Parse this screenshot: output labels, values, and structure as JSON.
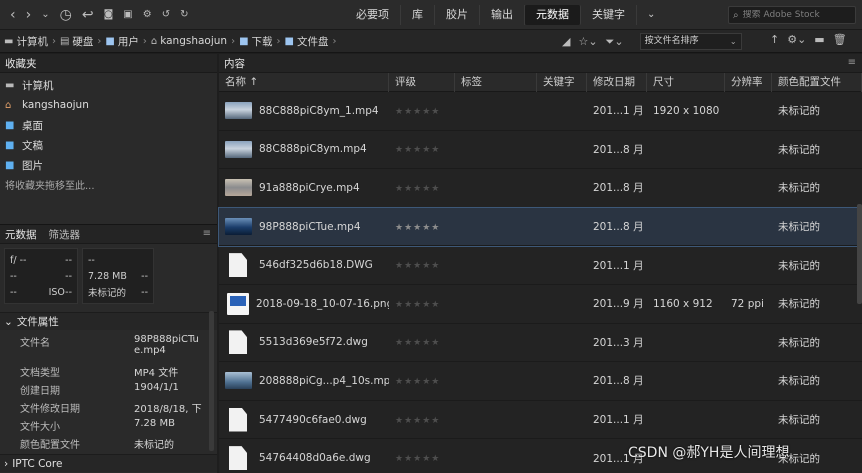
{
  "toolbar": {
    "tabs": [
      {
        "label": "必要项",
        "active": false
      },
      {
        "label": "库",
        "active": false
      },
      {
        "label": "胶片",
        "active": false
      },
      {
        "label": "输出",
        "active": false
      },
      {
        "label": "元数据",
        "active": true
      },
      {
        "label": "关键字",
        "active": false
      }
    ],
    "search_placeholder": "搜索 Adobe Stock"
  },
  "path": {
    "crumbs": [
      "计算机",
      "硬盘",
      "用户",
      "kangshaojun",
      "下载",
      "文件盘"
    ],
    "sort_label": "按文件名排序"
  },
  "favorites": {
    "title": "收藏夹",
    "tab2": "内容",
    "items": [
      "计算机",
      "kangshaojun",
      "桌面",
      "文稿",
      "图片"
    ],
    "hint": "将收藏夹拖移至此..."
  },
  "metadata": {
    "tab_meta": "元数据",
    "tab_filter": "筛选器",
    "box_a": [
      [
        "f/ --",
        "--"
      ],
      [
        "--",
        "--"
      ],
      [
        "--",
        "ISO--"
      ]
    ],
    "box_b": [
      [
        "--",
        ""
      ],
      [
        "7.28 MB",
        "--"
      ],
      [
        "未标记的",
        "--"
      ]
    ],
    "file_section": "文件属性",
    "props": [
      {
        "k": "文件名",
        "v": "98P888piCTue.mp4"
      },
      {
        "k": "文档类型",
        "v": "MP4 文件"
      },
      {
        "k": "创建日期",
        "v": "1904/1/1"
      },
      {
        "k": "文件修改日期",
        "v": "2018/8/18, 下"
      },
      {
        "k": "文件大小",
        "v": "7.28 MB"
      },
      {
        "k": "颜色配置文件",
        "v": "未标记的"
      }
    ],
    "iptc_section": "IPTC Core"
  },
  "columns": [
    "名称",
    "评级",
    "标签",
    "关键字",
    "修改日期",
    "尺寸",
    "分辨率",
    "颜色配置文件"
  ],
  "files": [
    {
      "name": "88C888piC8ym_1.mp4",
      "thumb": "video",
      "rating": "★★★★★",
      "date": "201...1 月",
      "size": "1920 x 1080",
      "res": "",
      "color": "未标记的",
      "selected": false
    },
    {
      "name": "88C888piC8ym.mp4",
      "thumb": "video",
      "rating": "★★★★★",
      "date": "201...8 月",
      "size": "",
      "res": "",
      "color": "未标记的",
      "selected": false
    },
    {
      "name": "91a888piCrye.mp4",
      "thumb": "sunset",
      "rating": "★★★★★",
      "date": "201...8 月",
      "size": "",
      "res": "",
      "color": "未标记的",
      "selected": false
    },
    {
      "name": "98P888piCTue.mp4",
      "thumb": "ocean",
      "rating": "★★★★★",
      "date": "201...8 月",
      "size": "",
      "res": "",
      "color": "未标记的",
      "selected": true
    },
    {
      "name": "546df325d6b18.DWG",
      "thumb": "doc",
      "rating": "★★★★★",
      "date": "201...1 月",
      "size": "",
      "res": "",
      "color": "未标记的",
      "selected": false
    },
    {
      "name": "2018-09-18_10-07-16.png",
      "thumb": "png",
      "rating": "★★★★★",
      "date": "201...9 月",
      "size": "1160 x 912",
      "res": "72 ppi",
      "color": "未标记的",
      "selected": false
    },
    {
      "name": "5513d369e5f72.dwg",
      "thumb": "doc",
      "rating": "★★★★★",
      "date": "201...3 月",
      "size": "",
      "res": "",
      "color": "未标记的",
      "selected": false
    },
    {
      "name": "208888piCg...p4_10s.mp4",
      "thumb": "land",
      "rating": "★★★★★",
      "date": "201...8 月",
      "size": "",
      "res": "",
      "color": "未标记的",
      "selected": false
    },
    {
      "name": "5477490c6fae0.dwg",
      "thumb": "doc",
      "rating": "★★★★★",
      "date": "201...1 月",
      "size": "",
      "res": "",
      "color": "未标记的",
      "selected": false
    },
    {
      "name": "54764408d0a6e.dwg",
      "thumb": "doc",
      "rating": "★★★★★",
      "date": "201...1 月",
      "size": "",
      "res": "",
      "color": "未标记的",
      "selected": false
    }
  ],
  "watermark": "CSDN @郝YH是人间理想"
}
